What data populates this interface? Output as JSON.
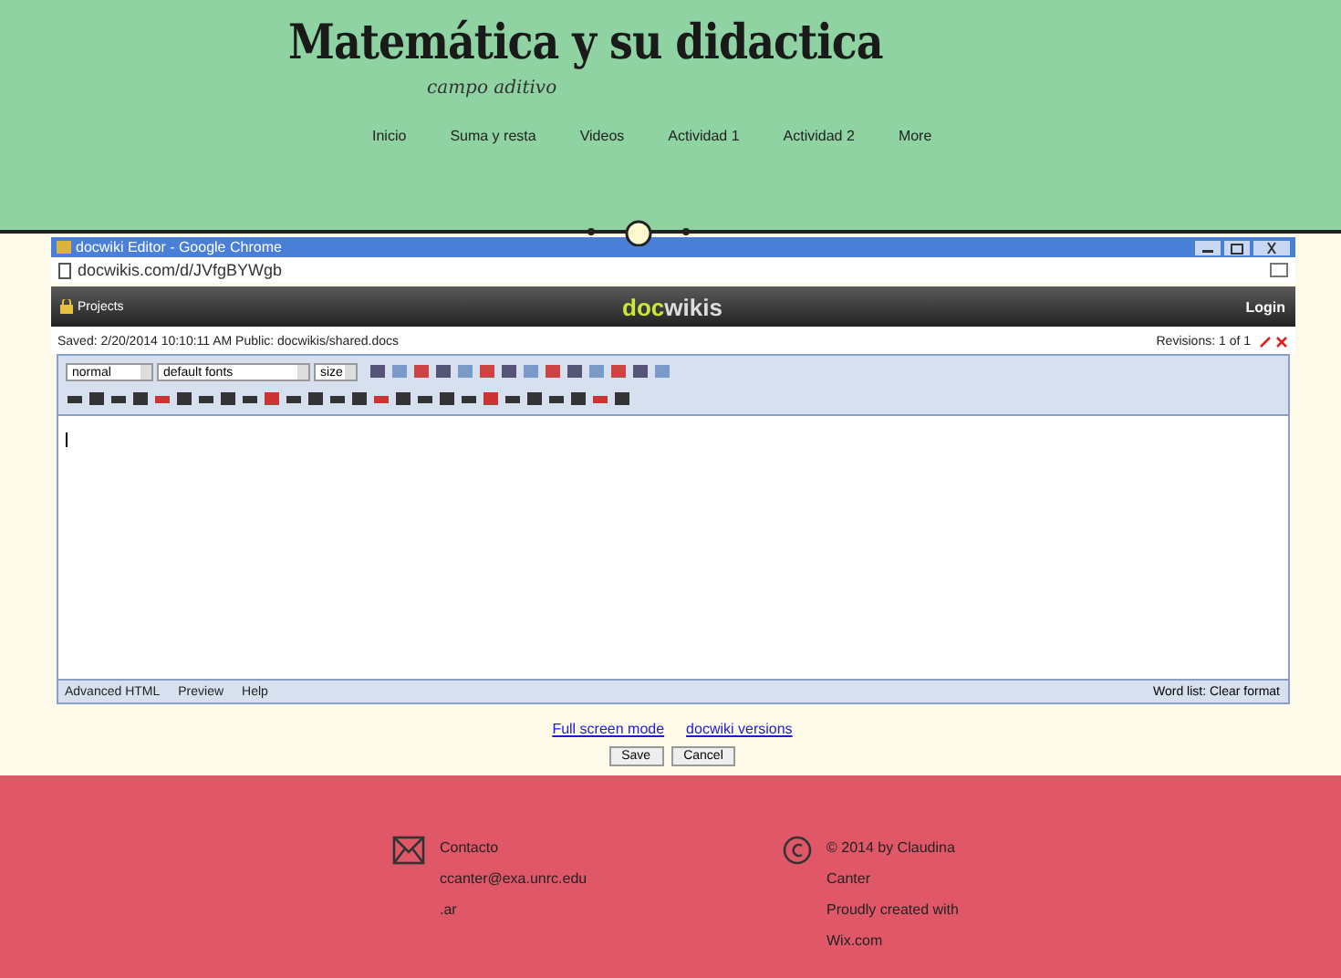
{
  "site": {
    "title": "Matemática y su didactica",
    "subtitle": "campo aditivo"
  },
  "nav": [
    {
      "label": "Inicio"
    },
    {
      "label": "Suma y resta"
    },
    {
      "label": "Videos"
    },
    {
      "label": "Actividad 1"
    },
    {
      "label": "Actividad 2"
    },
    {
      "label": "More"
    }
  ],
  "browser": {
    "title": "docwiki Editor - Google Chrome",
    "url": "docwikis.com/d/JVfgBYWgb"
  },
  "app_bar": {
    "left": "Projects",
    "logo_accent": "doc",
    "logo_rest": "wikis",
    "right": "Login"
  },
  "info": {
    "left": "Saved: 2/20/2014 10:10:11 AM   Public: docwikis/shared.docs",
    "right": "Revisions: 1 of 1"
  },
  "toolbar": {
    "format": "normal",
    "font": "default fonts",
    "size": "size"
  },
  "status": {
    "left": [
      "Advanced HTML",
      "Preview",
      "Help"
    ],
    "right": "Word list: Clear format"
  },
  "links": [
    "Full screen mode",
    "docwiki versions"
  ],
  "buttons": [
    "Save",
    "Cancel"
  ],
  "footer": {
    "contact": [
      "Contacto",
      "ccanter@exa.unrc.edu",
      ".ar"
    ],
    "credits": [
      "© 2014 by Claudina",
      "Canter",
      "Proudly created with",
      "Wix.com"
    ]
  }
}
